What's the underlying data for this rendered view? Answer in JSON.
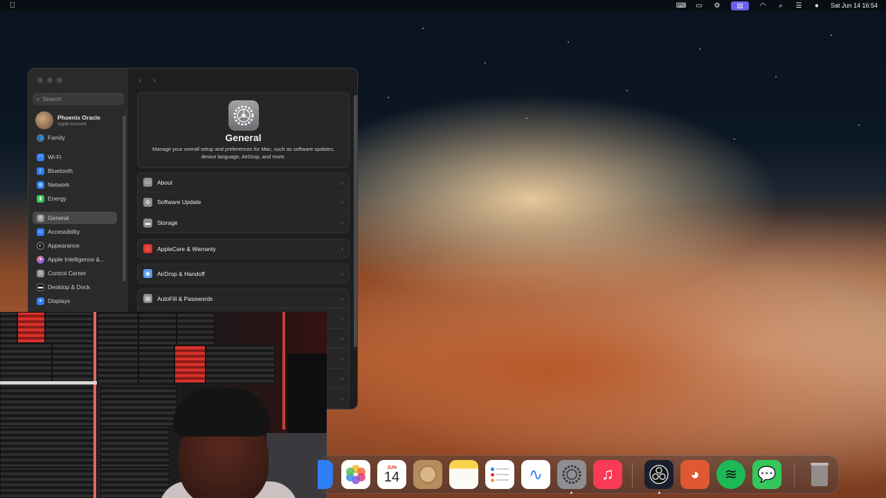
{
  "menubar": {
    "apple_icon": "apple-icon",
    "datetime": "Sat Jun 14  16:54",
    "status_icons": [
      "keyboard-icon",
      "display-icon",
      "gear-icon",
      "screen-share-icon",
      "wifi-icon",
      "search-icon",
      "control-center-icon",
      "siri-icon"
    ]
  },
  "settings": {
    "search_placeholder": "Search",
    "account": {
      "name": "Phoenix Oracle",
      "subtitle": "Apple Account"
    },
    "family_label": "Family",
    "sidebar_items": [
      {
        "label": "Wi-Fi",
        "color": "#2f7ff5",
        "icon": "wifi-icon"
      },
      {
        "label": "Bluetooth",
        "color": "#2f7ff5",
        "icon": "bluetooth-icon"
      },
      {
        "label": "Network",
        "color": "#2f7ff5",
        "icon": "globe-icon"
      },
      {
        "label": "Energy",
        "color": "#34c759",
        "icon": "battery-icon"
      },
      {
        "label": "General",
        "color": "#8e8e93",
        "icon": "gear-icon"
      },
      {
        "label": "Accessibility",
        "color": "#2f7ff5",
        "icon": "accessibility-icon"
      },
      {
        "label": "Appearance",
        "color": "#1c1c1e",
        "icon": "appearance-icon"
      },
      {
        "label": "Apple Intelligence &...",
        "color": "#c05ae0",
        "icon": "sparkle-icon"
      },
      {
        "label": "Control Center",
        "color": "#8e8e93",
        "icon": "control-center-icon"
      },
      {
        "label": "Desktop & Dock",
        "color": "#1c1c1e",
        "icon": "dock-icon"
      },
      {
        "label": "Displays",
        "color": "#2f7ff5",
        "icon": "display-icon"
      }
    ],
    "main": {
      "title": "General",
      "description": "Manage your overall setup and preferences for Mac, such as software updates, device language, AirDrop, and more.",
      "rows": [
        {
          "label": "About",
          "icon": "info-icon",
          "color": "#8e8e93"
        },
        {
          "label": "Software Update",
          "icon": "gear-icon",
          "color": "#8e8e93"
        },
        {
          "label": "Storage",
          "icon": "storage-icon",
          "color": "#8e8e93"
        },
        {
          "label": "AppleCare & Warranty",
          "icon": "apple-icon",
          "color": "#e0352b"
        },
        {
          "label": "AirDrop & Handoff",
          "icon": "airdrop-icon",
          "color": "#5a9cf0"
        },
        {
          "label": "AutoFill & Passwords",
          "icon": "key-icon",
          "color": "#8e8e93"
        }
      ]
    }
  },
  "dock": {
    "apps": [
      {
        "name": "photos-icon",
        "color": "#ffffff"
      },
      {
        "name": "calendar-icon",
        "color": "#ffffff",
        "month": "JUN",
        "day": "14"
      },
      {
        "name": "contacts-icon",
        "color": "#b58c5c"
      },
      {
        "name": "notes-icon",
        "color": "#f7d34b"
      },
      {
        "name": "reminders-icon",
        "color": "#ffffff"
      },
      {
        "name": "freeform-icon",
        "color": "#ffffff"
      },
      {
        "name": "system-settings-icon",
        "color": "#8e8e93"
      },
      {
        "name": "music-icon",
        "color": "#fb3a55"
      },
      {
        "name": "obs-icon",
        "color": "#1a1f2e"
      },
      {
        "name": "duckduckgo-icon",
        "color": "#de5833"
      },
      {
        "name": "spotify-icon",
        "color": "#1db954"
      },
      {
        "name": "messages-icon",
        "color": "#34c759"
      },
      {
        "name": "trash-icon",
        "color": "#9a9a9a"
      }
    ]
  }
}
